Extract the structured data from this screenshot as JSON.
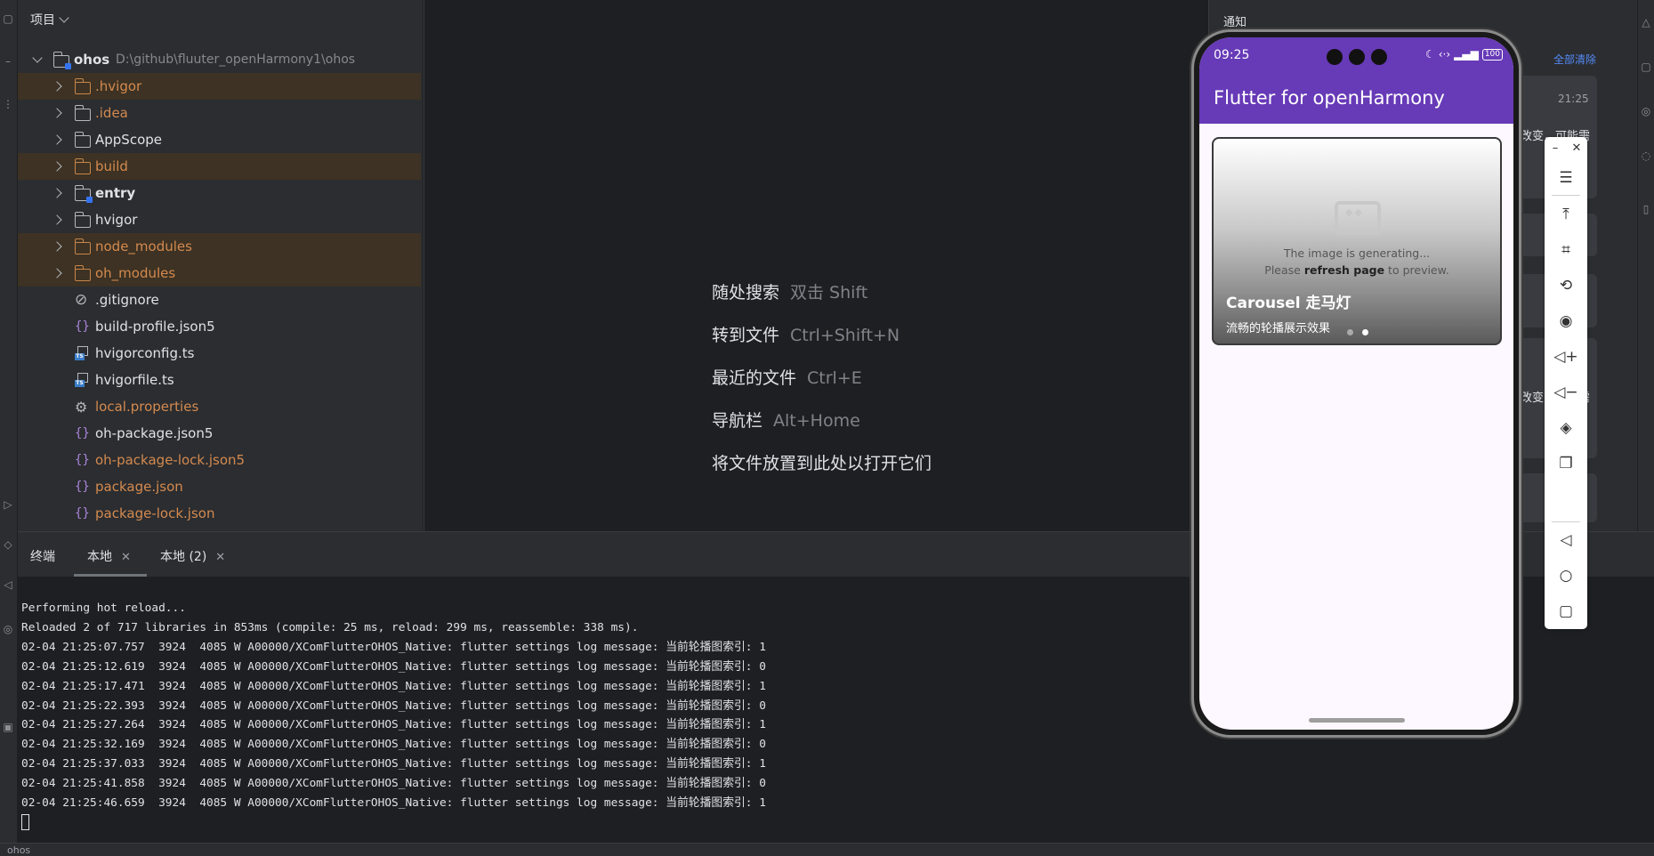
{
  "project": {
    "header": "项目",
    "root": {
      "name": "ohos",
      "path": "D:\\github\\fluuter_openHarmony1\\ohos"
    },
    "items": [
      {
        "label": ".hvigor",
        "kind": "folder",
        "excluded": true
      },
      {
        "label": ".idea",
        "kind": "folder",
        "excluded": false,
        "orange": true
      },
      {
        "label": "AppScope",
        "kind": "folder",
        "excluded": false
      },
      {
        "label": "build",
        "kind": "folder",
        "excluded": true
      },
      {
        "label": "entry",
        "kind": "module",
        "excluded": false
      },
      {
        "label": "hvigor",
        "kind": "folder",
        "excluded": false
      },
      {
        "label": "node_modules",
        "kind": "folder",
        "excluded": true
      },
      {
        "label": "oh_modules",
        "kind": "folder",
        "excluded": true
      },
      {
        "label": ".gitignore",
        "kind": "ignore"
      },
      {
        "label": "build-profile.json5",
        "kind": "json"
      },
      {
        "label": "hvigorconfig.ts",
        "kind": "ts"
      },
      {
        "label": "hvigorfile.ts",
        "kind": "ts"
      },
      {
        "label": "local.properties",
        "kind": "gear",
        "orange": true
      },
      {
        "label": "oh-package.json5",
        "kind": "json"
      },
      {
        "label": "oh-package-lock.json5",
        "kind": "json",
        "orange": true
      },
      {
        "label": "package.json",
        "kind": "json",
        "orange": true
      },
      {
        "label": "package-lock.json",
        "kind": "json",
        "orange": true
      }
    ]
  },
  "editor_hints": [
    {
      "label": "随处搜索",
      "shortcut": "双击 Shift"
    },
    {
      "label": "转到文件",
      "shortcut": "Ctrl+Shift+N"
    },
    {
      "label": "最近的文件",
      "shortcut": "Ctrl+E"
    },
    {
      "label": "导航栏",
      "shortcut": "Alt+Home"
    },
    {
      "label": "将文件放置到此处以打开它们",
      "shortcut": ""
    }
  ],
  "notifications": {
    "title": "通知",
    "clear_all": "全部清除",
    "time": "21:25",
    "snippet1": "改变，可能需",
    "snippet2": "改变，可能需"
  },
  "terminal": {
    "title": "终端",
    "tabs": [
      "本地",
      "本地 (2)"
    ],
    "lines": [
      "Performing hot reload...",
      "Reloaded 2 of 717 libraries in 853ms (compile: 25 ms, reload: 299 ms, reassemble: 338 ms).",
      "02-04 21:25:07.757  3924  4085 W A00000/XComFlutterOHOS_Native: flutter settings log message: 当前轮播图索引: 1",
      "02-04 21:25:12.619  3924  4085 W A00000/XComFlutterOHOS_Native: flutter settings log message: 当前轮播图索引: 0",
      "02-04 21:25:17.471  3924  4085 W A00000/XComFlutterOHOS_Native: flutter settings log message: 当前轮播图索引: 1",
      "02-04 21:25:22.393  3924  4085 W A00000/XComFlutterOHOS_Native: flutter settings log message: 当前轮播图索引: 0",
      "02-04 21:25:27.264  3924  4085 W A00000/XComFlutterOHOS_Native: flutter settings log message: 当前轮播图索引: 1",
      "02-04 21:25:32.169  3924  4085 W A00000/XComFlutterOHOS_Native: flutter settings log message: 当前轮播图索引: 0",
      "02-04 21:25:37.033  3924  4085 W A00000/XComFlutterOHOS_Native: flutter settings log message: 当前轮播图索引: 1",
      "02-04 21:25:41.858  3924  4085 W A00000/XComFlutterOHOS_Native: flutter settings log message: 当前轮播图索引: 0",
      "02-04 21:25:46.659  3924  4085 W A00000/XComFlutterOHOS_Native: flutter settings log message: 当前轮播图索引: 1"
    ]
  },
  "status_bar": {
    "project": "ohos"
  },
  "phone": {
    "time": "09:25",
    "battery": "100",
    "app_title": "Flutter for openHarmony",
    "carousel": {
      "generating_line1": "The image is generating...",
      "generating_pre": "Please ",
      "generating_bold": "refresh page",
      "generating_post": " to preview.",
      "title": "Carousel 走马灯",
      "subtitle": "流畅的轮播展示效果",
      "active_index": 1,
      "dot_count": 2
    }
  },
  "emulator_toolbar": {
    "icons": [
      "minimize-icon",
      "close-icon",
      "menu-icon",
      "pin-top-icon",
      "screenshot-crop-icon",
      "rotate-icon",
      "record-icon",
      "volume-up-icon",
      "volume-down-icon",
      "shake-icon",
      "fold-icon",
      "back-icon",
      "home-icon",
      "recents-icon"
    ]
  },
  "colors": {
    "accent": "#673ab7",
    "ide_bg": "#1e1f22",
    "panel_bg": "#2b2d30",
    "excluded_row": "#3d3223",
    "excluded_text": "#d48a4f"
  }
}
